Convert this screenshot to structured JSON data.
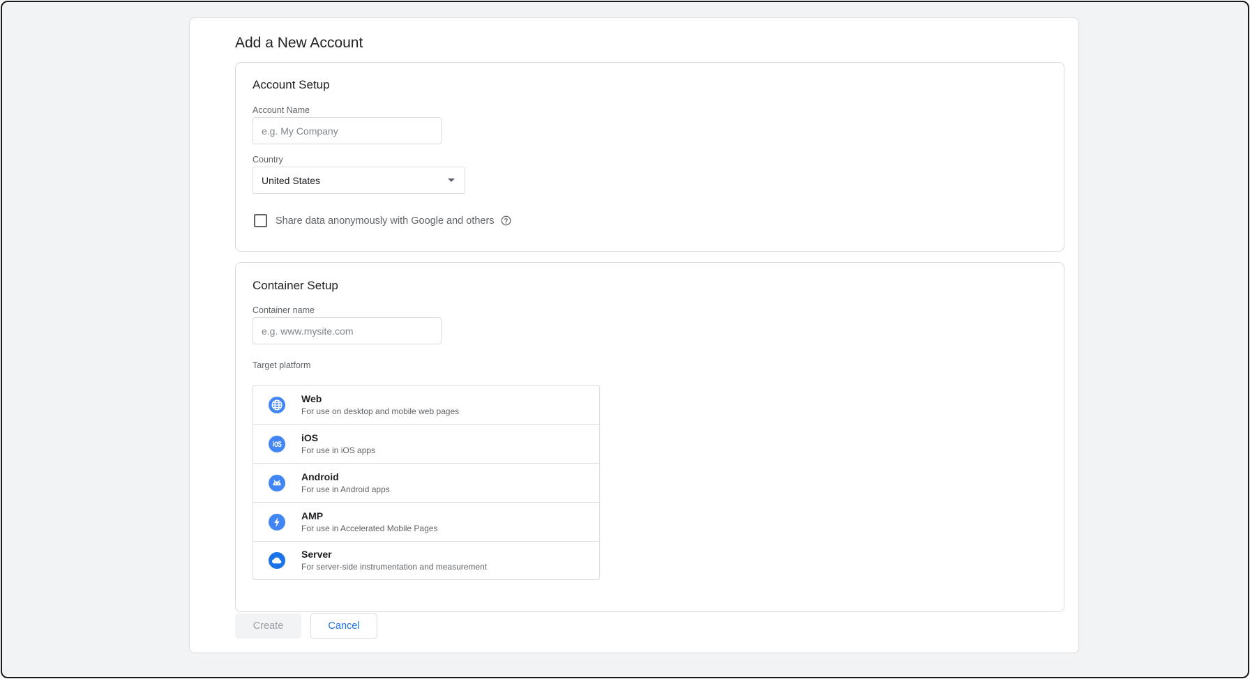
{
  "page": {
    "title": "Add a New Account"
  },
  "account_setup": {
    "title": "Account Setup",
    "account_name": {
      "label": "Account Name",
      "value": "",
      "placeholder": "e.g. My Company"
    },
    "country": {
      "label": "Country",
      "value": "United States"
    },
    "share_data": {
      "label": "Share data anonymously with Google and others",
      "checked": false
    }
  },
  "container_setup": {
    "title": "Container Setup",
    "container_name": {
      "label": "Container name",
      "value": "",
      "placeholder": "e.g. www.mysite.com"
    },
    "target_platform": {
      "label": "Target platform",
      "items": [
        {
          "name": "Web",
          "description": "For use on desktop and mobile web pages",
          "icon": "globe-icon"
        },
        {
          "name": "iOS",
          "description": "For use in iOS apps",
          "icon": "ios-icon"
        },
        {
          "name": "Android",
          "description": "For use in Android apps",
          "icon": "android-icon"
        },
        {
          "name": "AMP",
          "description": "For use in Accelerated Mobile Pages",
          "icon": "amp-bolt-icon"
        },
        {
          "name": "Server",
          "description": "For server-side instrumentation and measurement",
          "icon": "cloud-icon"
        }
      ]
    }
  },
  "actions": {
    "create_label": "Create",
    "cancel_label": "Cancel"
  },
  "colors": {
    "accent": "#1a73e8",
    "icon_blue": "#4285f4",
    "border": "#dadce0",
    "background": "#f1f3f4"
  }
}
